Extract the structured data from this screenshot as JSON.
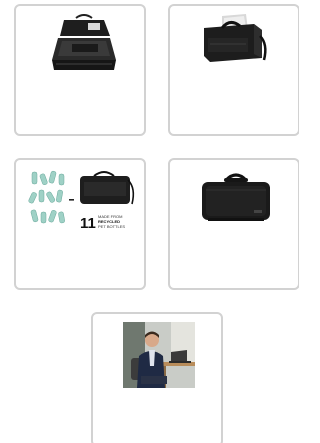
{
  "products": [
    {
      "image": "laptop-bag-open-topview",
      "kind": "photo"
    },
    {
      "image": "laptop-bag-with-laptop-inside",
      "kind": "photo"
    },
    {
      "image": "recycled-bottles-infographic",
      "kind": "infographic",
      "infographic": {
        "number": "11",
        "line1": "MADE FROM",
        "line2": "RECYCLED",
        "line3": "PET BOTTLES"
      }
    },
    {
      "image": "laptop-bag-front-closed",
      "kind": "photo"
    },
    {
      "image": "man-in-suit-with-laptop-bag",
      "kind": "photo"
    }
  ]
}
